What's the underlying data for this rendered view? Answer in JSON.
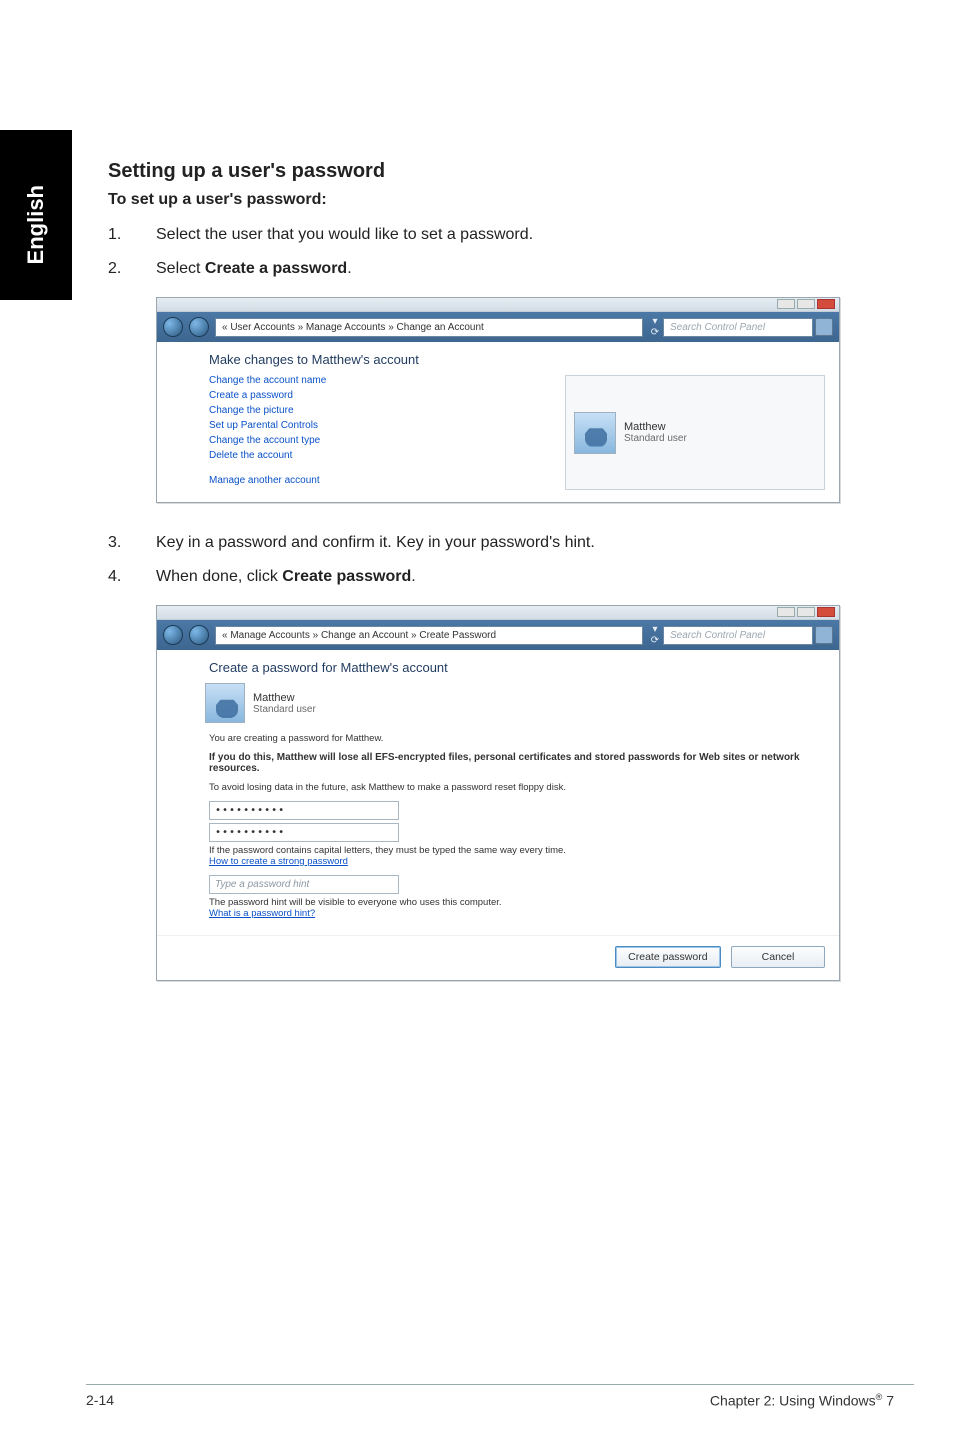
{
  "sidebar": {
    "label": "English"
  },
  "page": {
    "title": "Setting up a user's password",
    "subtitle": "To set up a user's password:",
    "steps1": [
      {
        "num": "1.",
        "pre": "Select the user that you would like to set a password."
      },
      {
        "num": "2.",
        "pre": "Select ",
        "bold": "Create a password",
        "post": "."
      }
    ],
    "steps2": [
      {
        "num": "3.",
        "pre": "Key in a password and confirm it. Key in your password's hint."
      },
      {
        "num": "4.",
        "pre": "When done, click ",
        "bold": "Create password",
        "post": "."
      }
    ]
  },
  "dialog1": {
    "breadcrumb": "« User Accounts » Manage Accounts » Change an Account",
    "search_separator": "▾ ⟳",
    "search_placeholder": "Search Control Panel",
    "heading": "Make changes to Matthew's account",
    "links": [
      "Change the account name",
      "Create a password",
      "Change the picture",
      "Set up Parental Controls",
      "Change the account type",
      "Delete the account"
    ],
    "link_manage": "Manage another account",
    "user": {
      "name": "Matthew",
      "type": "Standard user"
    }
  },
  "dialog2": {
    "breadcrumb": "« Manage Accounts » Change an Account » Create Password",
    "search_separator": "▾ ⟳",
    "search_placeholder": "Search Control Panel",
    "heading": "Create a password for Matthew's account",
    "user": {
      "name": "Matthew",
      "type": "Standard user"
    },
    "lead": "You are creating a password for Matthew.",
    "warn": "If you do this, Matthew will lose all EFS-encrypted files, personal certificates and stored passwords for Web sites or network resources.",
    "advice": "To avoid losing data in the future, ask Matthew to make a password reset floppy disk.",
    "pw1": "••••••••••",
    "pw2": "••••••••••",
    "caps_note": "If the password contains capital letters, they must be typed the same way every time.",
    "strong_link": "How to create a strong password",
    "hint_placeholder": "Type a password hint",
    "hint_note": "The password hint will be visible to everyone who uses this computer.",
    "hint_link": "What is a password hint?",
    "btn_primary": "Create password",
    "btn_cancel": "Cancel"
  },
  "footer": {
    "left": "2-14",
    "right_pre": "Chapter 2: Using Windows",
    "right_sup": "®",
    "right_post": " 7"
  }
}
